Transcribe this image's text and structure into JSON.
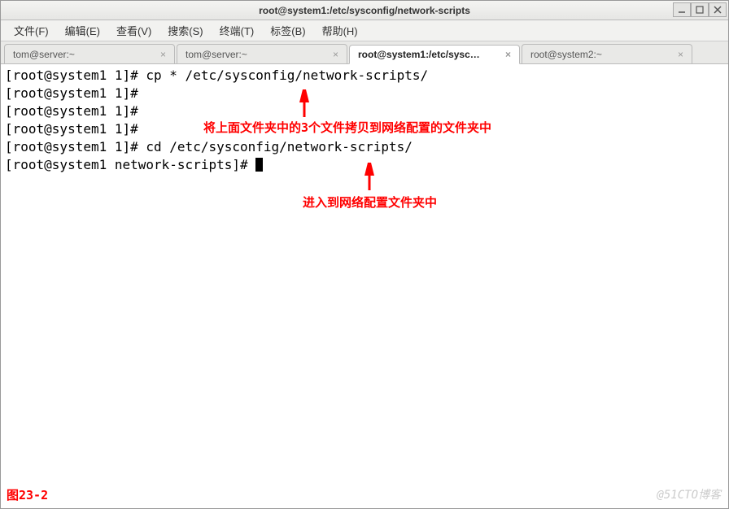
{
  "window": {
    "title": "root@system1:/etc/sysconfig/network-scripts"
  },
  "menu": {
    "file": "文件(F)",
    "edit": "编辑(E)",
    "view": "查看(V)",
    "search": "搜索(S)",
    "terminal": "终端(T)",
    "tabs": "标签(B)",
    "help": "帮助(H)"
  },
  "tabs": [
    {
      "label": "tom@server:~",
      "active": false
    },
    {
      "label": "tom@server:~",
      "active": false
    },
    {
      "label": "root@system1:/etc/sysc…",
      "active": true
    },
    {
      "label": "root@system2:~",
      "active": false
    }
  ],
  "terminal": {
    "lines": [
      "[root@system1 1]# cp * /etc/sysconfig/network-scripts/",
      "[root@system1 1]# ",
      "[root@system1 1]# ",
      "[root@system1 1]# ",
      "[root@system1 1]# cd /etc/sysconfig/network-scripts/",
      "[root@system1 network-scripts]# "
    ]
  },
  "annotations": {
    "note1": "将上面文件夹中的3个文件拷贝到网络配置的文件夹中",
    "note2": "进入到网络配置文件夹中",
    "figure": "图23-2"
  },
  "watermark": "@51CTO博客"
}
